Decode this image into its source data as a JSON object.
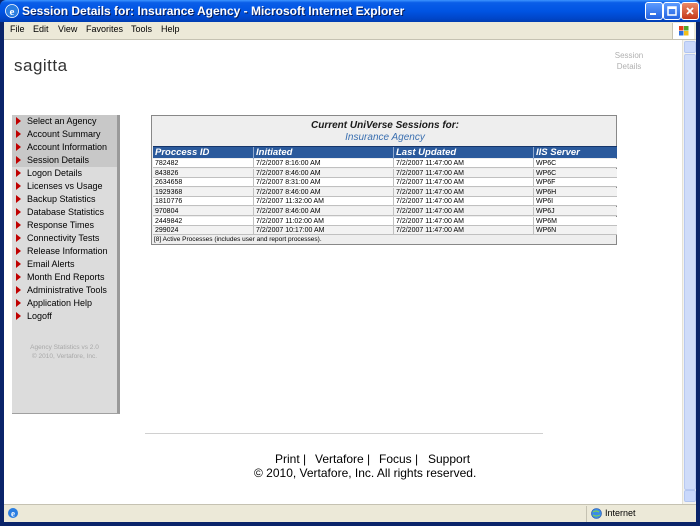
{
  "window": {
    "title": "Session Details for: Insurance Agency - Microsoft Internet Explorer"
  },
  "menu": [
    "File",
    "Edit",
    "View",
    "Favorites",
    "Tools",
    "Help"
  ],
  "page": {
    "logo": "sagitta",
    "label": "Session Details"
  },
  "sidebar": {
    "items": [
      "Select an Agency",
      "Account Summary",
      "Account Information",
      "Session Details",
      "Logon Details",
      "Licenses vs Usage",
      "Backup Statistics",
      "Database Statistics",
      "Response Times",
      "Connectivity Tests",
      "Release Information",
      "Email Alerts",
      "Month End Reports",
      "Administrative Tools",
      "Application Help",
      "Logoff"
    ],
    "footer_line1": "Agency Statistics vs 2.0",
    "footer_line2": "© 2010, Vertafore, Inc."
  },
  "sessions": {
    "heading": "Current UniVerse Sessions for:",
    "agency": "Insurance Agency",
    "columns": [
      "Proccess ID",
      "Initiated",
      "Last Updated",
      "IIS Server"
    ],
    "rows": [
      [
        "782482",
        "7/2/2007 8:16:00 AM",
        "7/2/2007 11:47:00 AM",
        "WP6C"
      ],
      [
        "843826",
        "7/2/2007 8:46:00 AM",
        "7/2/2007 11:47:00 AM",
        "WP6C"
      ],
      [
        "2634658",
        "7/2/2007 8:31:00 AM",
        "7/2/2007 11:47:00 AM",
        "WP6F"
      ],
      [
        "1929368",
        "7/2/2007 8:46:00 AM",
        "7/2/2007 11:47:00 AM",
        "WP6H"
      ],
      [
        "1810776",
        "7/2/2007 11:32:00 AM",
        "7/2/2007 11:47:00 AM",
        "WP6I"
      ],
      [
        "970804",
        "7/2/2007 8:46:00 AM",
        "7/2/2007 11:47:00 AM",
        "WP6J"
      ],
      [
        "2449842",
        "7/2/2007 11:02:00 AM",
        "7/2/2007 11:47:00 AM",
        "WP6M"
      ],
      [
        "299024",
        "7/2/2007 10:17:00 AM",
        "7/2/2007 11:47:00 AM",
        "WP6N"
      ]
    ],
    "footnote": "[8] Active Processes (includes user and report processes)."
  },
  "footer": {
    "links": [
      "Print |",
      "Vertafore |",
      "Focus |",
      "Support"
    ],
    "copyright": "© 2010,  Vertafore, Inc. All rights reserved."
  },
  "status": {
    "zone": "Internet"
  },
  "colors": {
    "titlebar": "#0054e3",
    "table_header": "#2b5a9c",
    "nav_arrow": "#c00000",
    "agency_text": "#3a6fb0"
  }
}
